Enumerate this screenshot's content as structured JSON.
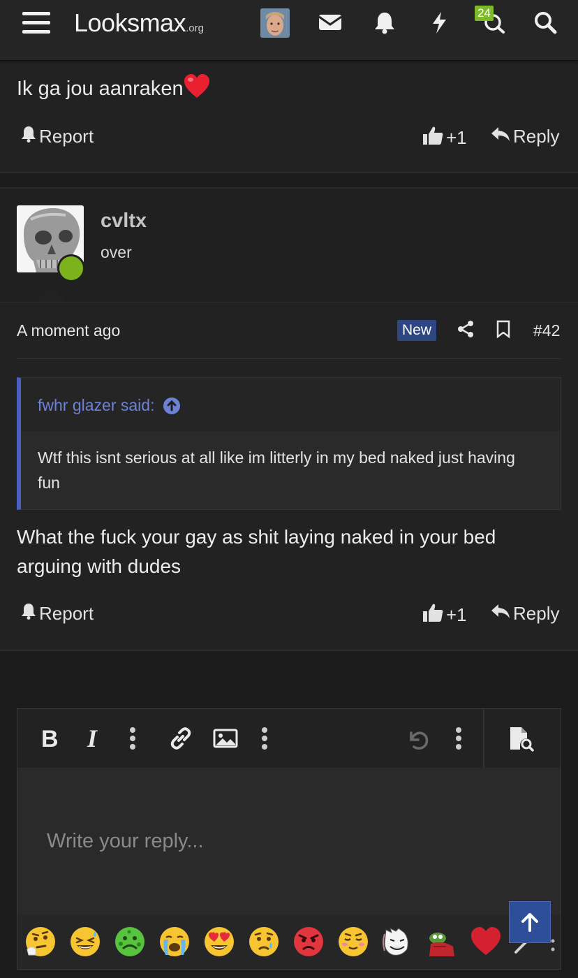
{
  "header": {
    "logo_main": "Looksmax",
    "logo_suffix": ".org",
    "notification_count": "24"
  },
  "posts": [
    {
      "message": "Ik ga jou aanraken",
      "actions": {
        "report": "Report",
        "like_count": "+1",
        "reply": "Reply"
      }
    },
    {
      "username": "cvltx",
      "user_title": "over",
      "timestamp": "A moment ago",
      "new_badge": "New",
      "post_number": "#42",
      "quote": {
        "author": "fwhr glazer said:",
        "text": "Wtf this isnt serious at all like im litterly in my bed naked just having fun"
      },
      "message": "What the fuck your gay as shit laying naked in your bed arguing with dudes",
      "actions": {
        "report": "Report",
        "like_count": "+1",
        "reply": "Reply"
      }
    }
  ],
  "editor": {
    "placeholder": "Write your reply...",
    "emojis": [
      "thinking-face",
      "grinning-squinting-sweat",
      "nauseated-face",
      "loudly-crying-face",
      "heart-eyes",
      "crying-face",
      "angry-face",
      "relieved-face",
      "troll-meme",
      "pepe-frog",
      "red-heart"
    ]
  }
}
